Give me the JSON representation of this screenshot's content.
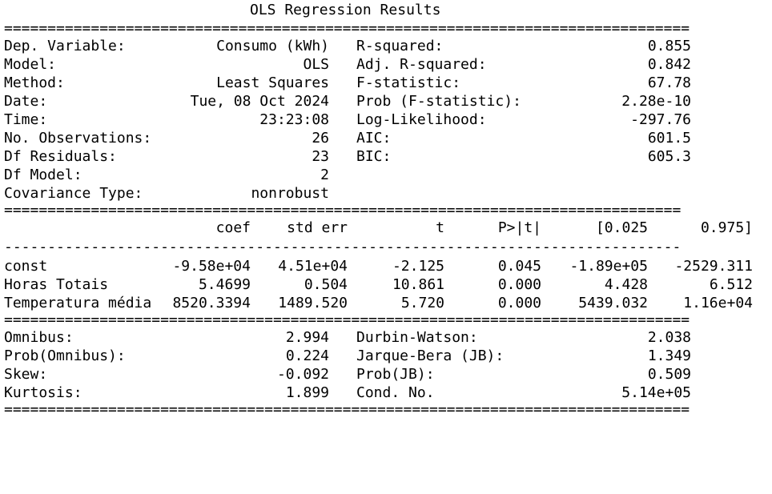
{
  "title": "OLS Regression Results",
  "separator_eq_short": "===============================================================================",
  "separator_eq_long": "==============================================================================",
  "separator_dash_long": "------------------------------------------------------------------------------",
  "model_info": {
    "left": [
      {
        "label": "Dep. Variable:",
        "value": "Consumo (kWh)"
      },
      {
        "label": "Model:",
        "value": "OLS"
      },
      {
        "label": "Method:",
        "value": "Least Squares"
      },
      {
        "label": "Date:",
        "value": "Tue, 08 Oct 2024"
      },
      {
        "label": "Time:",
        "value": "23:23:08"
      },
      {
        "label": "No. Observations:",
        "value": "26"
      },
      {
        "label": "Df Residuals:",
        "value": "23"
      },
      {
        "label": "Df Model:",
        "value": "2"
      },
      {
        "label": "Covariance Type:",
        "value": "nonrobust"
      }
    ],
    "right": [
      {
        "label": "R-squared:",
        "value": "0.855"
      },
      {
        "label": "Adj. R-squared:",
        "value": "0.842"
      },
      {
        "label": "F-statistic:",
        "value": "67.78"
      },
      {
        "label": "Prob (F-statistic):",
        "value": "2.28e-10"
      },
      {
        "label": "Log-Likelihood:",
        "value": "-297.76"
      },
      {
        "label": "AIC:",
        "value": "601.5"
      },
      {
        "label": "BIC:",
        "value": "605.3"
      }
    ]
  },
  "coef_table": {
    "headers": [
      "coef",
      "std err",
      "t",
      "P>|t|",
      "[0.025",
      "0.975]"
    ],
    "rows": [
      {
        "name": "const",
        "values": [
          "-9.58e+04",
          "4.51e+04",
          "-2.125",
          "0.045",
          "-1.89e+05",
          "-2529.311"
        ]
      },
      {
        "name": "Horas Totais",
        "values": [
          "5.4699",
          "0.504",
          "10.861",
          "0.000",
          "4.428",
          "6.512"
        ]
      },
      {
        "name": "Temperatura média",
        "values": [
          "8520.3394",
          "1489.520",
          "5.720",
          "0.000",
          "5439.032",
          "1.16e+04"
        ]
      }
    ]
  },
  "diagnostics": {
    "left": [
      {
        "label": "Omnibus:",
        "value": "2.994"
      },
      {
        "label": "Prob(Omnibus):",
        "value": "0.224"
      },
      {
        "label": "Skew:",
        "value": "-0.092"
      },
      {
        "label": "Kurtosis:",
        "value": "1.899"
      }
    ],
    "right": [
      {
        "label": "Durbin-Watson:",
        "value": "2.038"
      },
      {
        "label": "Jarque-Bera (JB):",
        "value": "1.349"
      },
      {
        "label": "Prob(JB):",
        "value": "0.509"
      },
      {
        "label": "Cond. No.",
        "value": "5.14e+05"
      }
    ]
  }
}
